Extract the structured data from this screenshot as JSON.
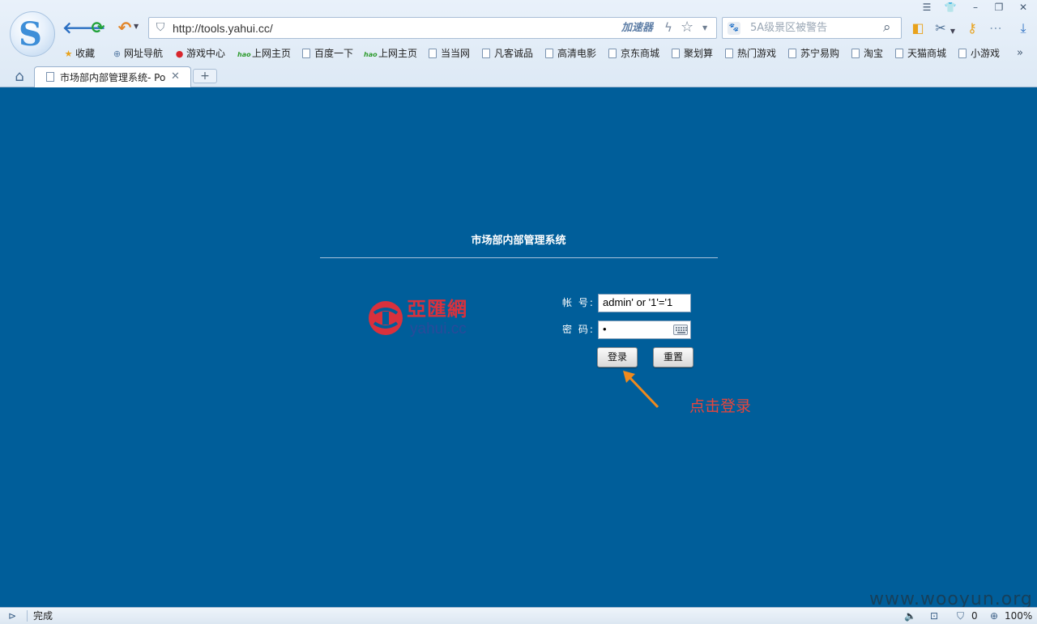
{
  "window_controls": {
    "menu_icon": "menu-icon",
    "skin_icon": "tshirt-icon",
    "minimize": "–",
    "restore": "❐",
    "close": "✕"
  },
  "toolbar": {
    "back": "🡐",
    "refresh": "⟳",
    "undo": "↶",
    "url": "http://tools.yahui.cc/",
    "accelerator_label": "加速器",
    "search_placeholder": "5A级景区被警告"
  },
  "bookmarks": [
    {
      "label": "收藏",
      "icon": "star-icon"
    },
    {
      "label": "网址导航",
      "icon": "globe-icon"
    },
    {
      "label": "游戏中心",
      "icon": "game-icon"
    },
    {
      "label": "上网主页",
      "icon": "hao-icon"
    },
    {
      "label": "百度一下",
      "icon": "page-icon"
    },
    {
      "label": "上网主页",
      "icon": "hao-icon"
    },
    {
      "label": "当当网",
      "icon": "page-icon"
    },
    {
      "label": "凡客诚品",
      "icon": "page-icon"
    },
    {
      "label": "高清电影",
      "icon": "page-icon"
    },
    {
      "label": "京东商城",
      "icon": "page-icon"
    },
    {
      "label": "聚划算",
      "icon": "page-icon"
    },
    {
      "label": "热门游戏",
      "icon": "page-icon"
    },
    {
      "label": "苏宁易购",
      "icon": "page-icon"
    },
    {
      "label": "淘宝",
      "icon": "page-icon"
    },
    {
      "label": "天猫商城",
      "icon": "page-icon"
    },
    {
      "label": "小游戏",
      "icon": "page-icon"
    }
  ],
  "tabs": [
    {
      "title": "市场部内部管理系统- Po",
      "active": true
    }
  ],
  "page": {
    "title": "市场部内部管理系统",
    "brand_cn": "亞匯網",
    "brand_en": "yahui.cc",
    "account_label": "帐  号:",
    "password_label": "密  码:",
    "account_value": "admin' or '1'='1",
    "password_value": "•",
    "login_button": "登录",
    "reset_button": "重置",
    "annotation": "点击登录"
  },
  "status_bar": {
    "status_text": "完成",
    "zoom": "100%",
    "ad_count": "0"
  },
  "watermark": "www.wooyun.org",
  "colors": {
    "page_background": "#005e9a",
    "annotation": "#e8453c",
    "brand_red": "#d9313d",
    "brand_blue": "#2a4a9a"
  }
}
